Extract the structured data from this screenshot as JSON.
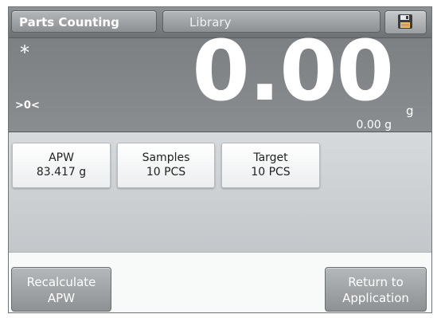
{
  "header": {
    "app_tab": "Parts Counting",
    "library_tab": "Library",
    "save_icon": "floppy-disk-icon"
  },
  "display": {
    "stable_indicator": "*",
    "zero_indicator": ">0<",
    "weight": "0.00",
    "unit": "g",
    "secondary_weight": "0.00 g"
  },
  "fields": {
    "apw": {
      "label": "APW",
      "value": "83.417 g"
    },
    "samples": {
      "label": "Samples",
      "value": "10 PCS"
    },
    "target": {
      "label": "Target",
      "value": "10 PCS"
    }
  },
  "buttons": {
    "recalculate": {
      "line1": "Recalculate",
      "line2": "APW"
    },
    "return": {
      "line1": "Return to",
      "line2": "Application"
    }
  },
  "colors": {
    "bar": "#7f8285",
    "display": "#84878a",
    "panel": "#cfd2d5",
    "button": "#a3a6a8"
  }
}
